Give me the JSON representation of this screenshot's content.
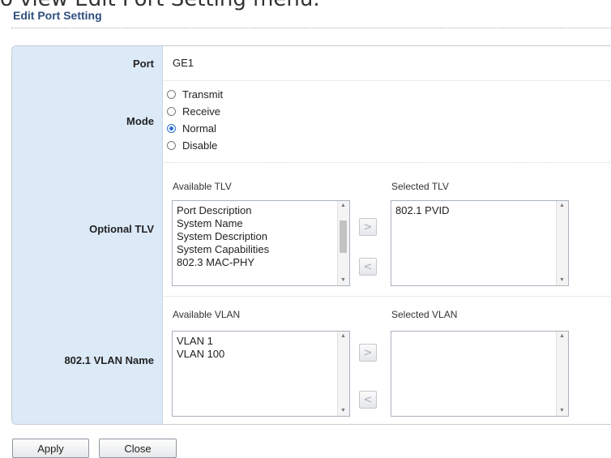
{
  "caption": "o view Edit Port Setting menu.",
  "section_title": "Edit Port Setting",
  "port": {
    "label": "Port",
    "value": "GE1"
  },
  "mode": {
    "label": "Mode",
    "options": [
      "Transmit",
      "Receive",
      "Normal",
      "Disable"
    ],
    "selected": "Normal"
  },
  "optional_tlv": {
    "label": "Optional TLV",
    "available_header": "Available TLV",
    "selected_header": "Selected TLV",
    "available": [
      "Port Description",
      "System Name",
      "System Description",
      "System Capabilities",
      "802.3 MAC-PHY"
    ],
    "selected": [
      "802.1 PVID"
    ]
  },
  "vlan_name": {
    "label": "802.1 VLAN Name",
    "available_header": "Available VLAN",
    "selected_header": "Selected VLAN",
    "available": [
      "VLAN 1",
      "VLAN 100"
    ],
    "selected": []
  },
  "icons": {
    "move_right": "chevron-right-icon",
    "move_left": "chevron-left-icon"
  },
  "buttons": {
    "apply": "Apply",
    "close": "Close"
  },
  "colors": {
    "label_bg": "#dce9f7",
    "title": "#2f4f7f",
    "radio_selected": "#2e6fd0"
  }
}
